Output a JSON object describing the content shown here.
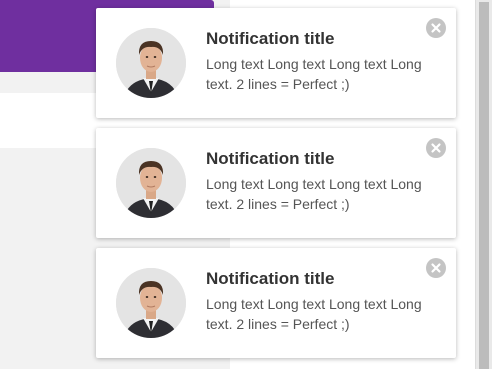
{
  "notifications": [
    {
      "title": "Notification title",
      "body": "Long text Long text Long text Long text. 2 lines = Perfect ;)",
      "avatar_icon": "person-avatar-icon",
      "close_icon": "close-icon"
    },
    {
      "title": "Notification title",
      "body": "Long text Long text Long text Long text. 2 lines = Perfect ;)",
      "avatar_icon": "person-avatar-icon",
      "close_icon": "close-icon"
    },
    {
      "title": "Notification title",
      "body": "Long text Long text Long text Long text. 2 lines = Perfect ;)",
      "avatar_icon": "person-avatar-icon",
      "close_icon": "close-icon"
    }
  ],
  "colors": {
    "header_accent": "#6f2f9f",
    "card_bg": "#ffffff",
    "close_button": "#c4c4c4",
    "title_text": "#333333",
    "body_text": "#555555"
  }
}
